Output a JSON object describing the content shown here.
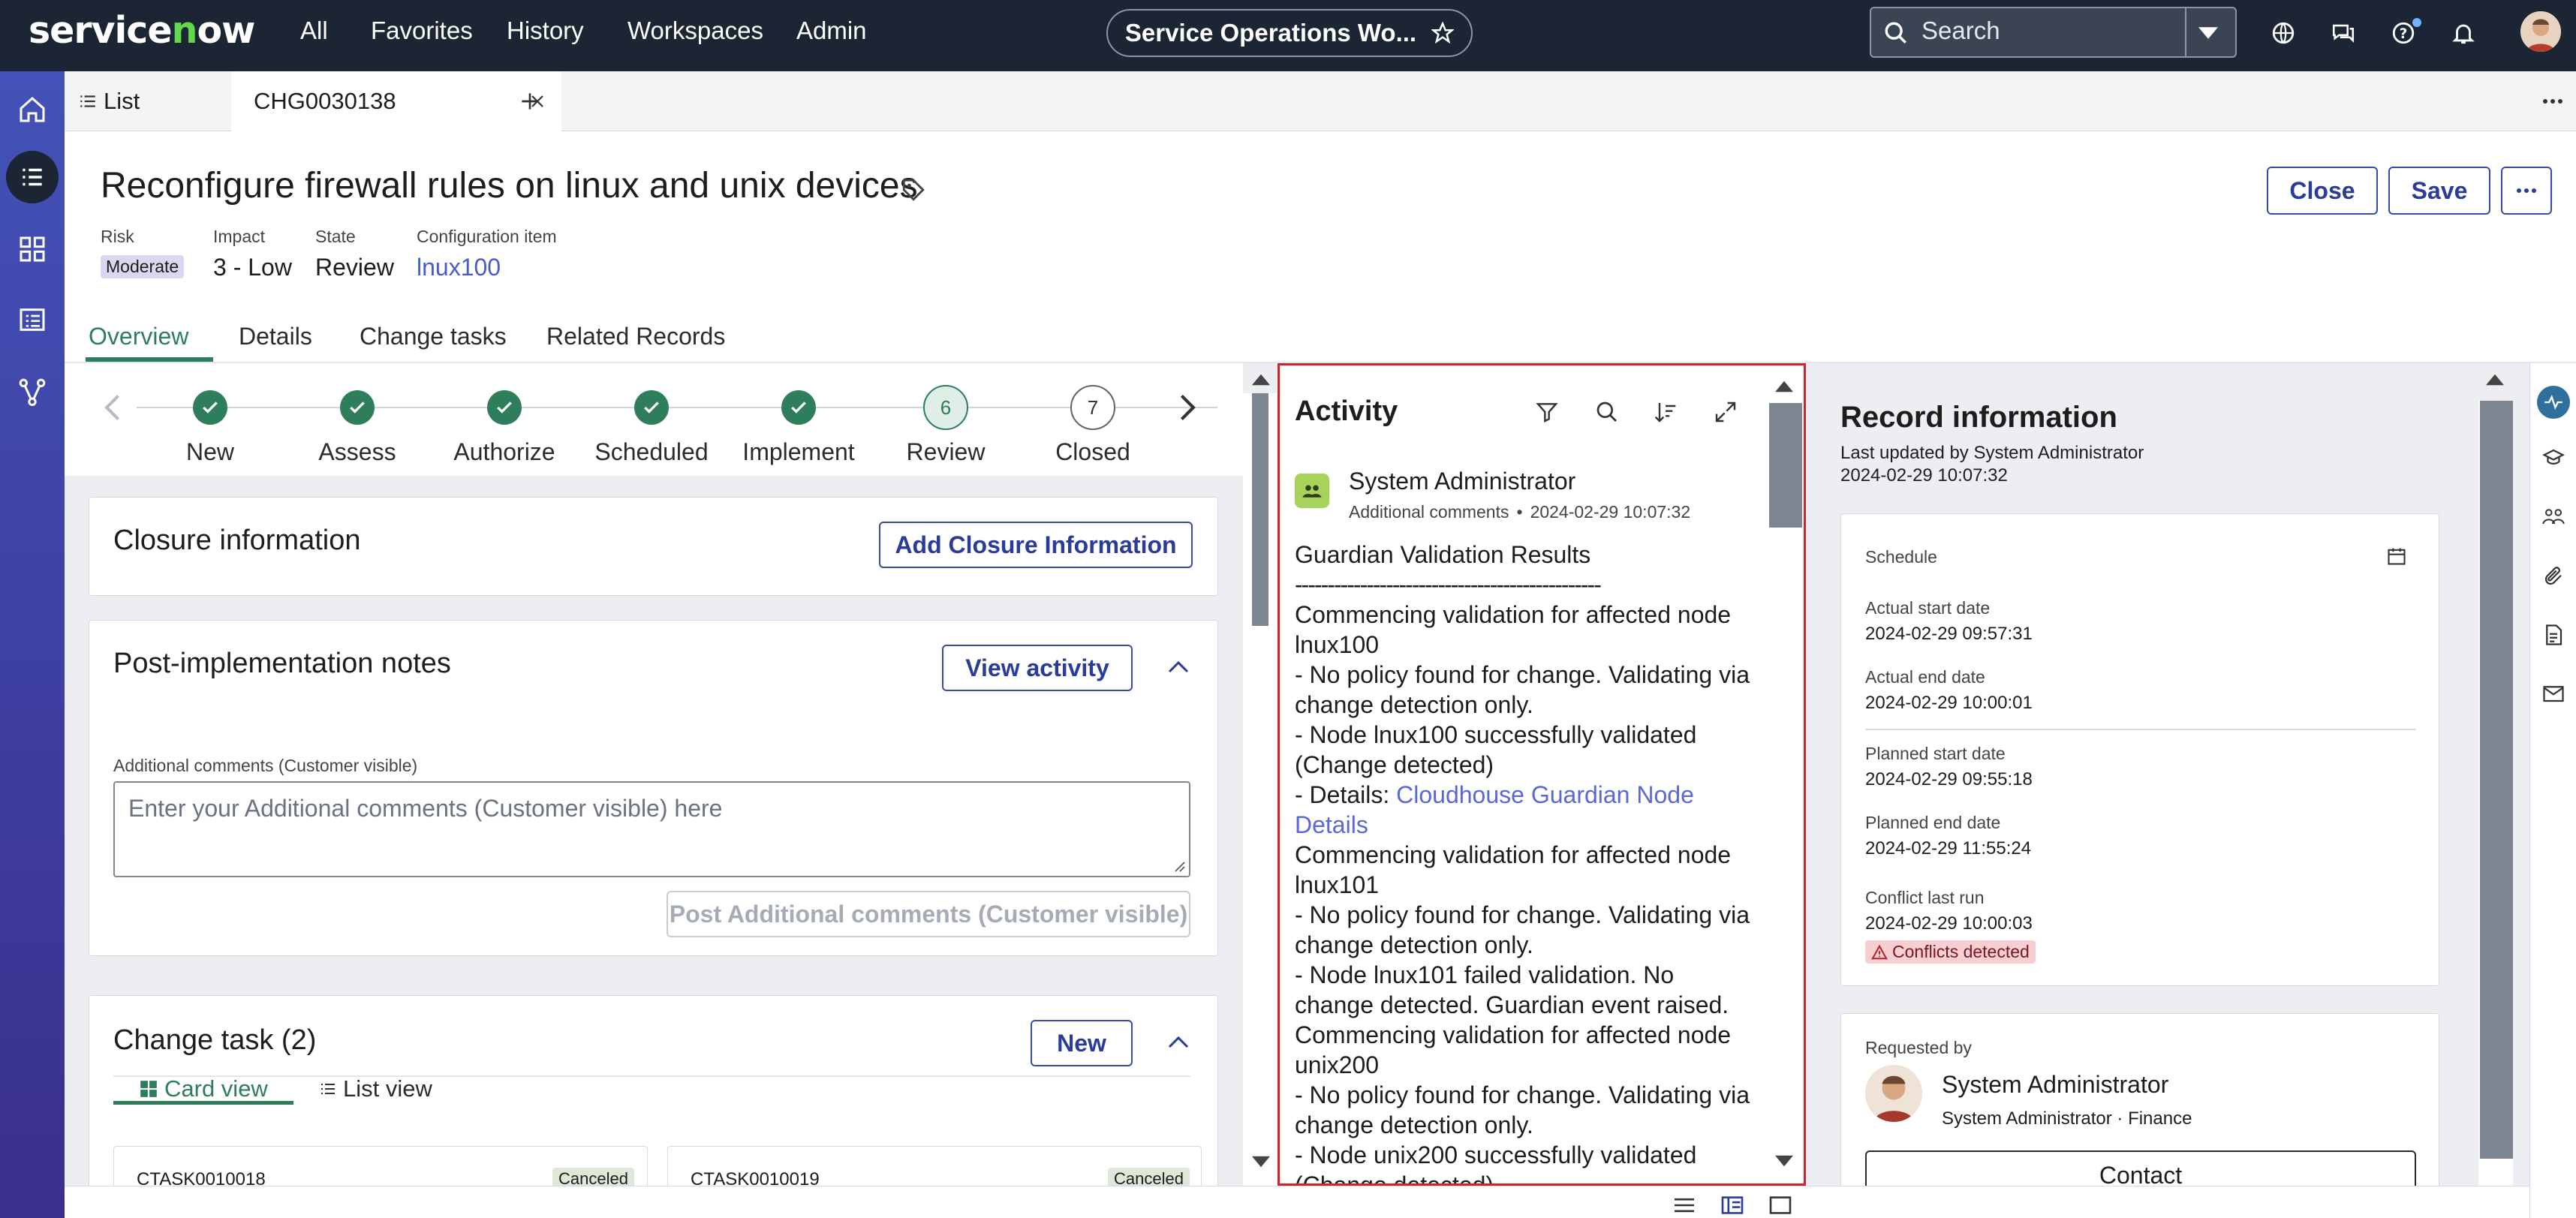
{
  "topbar": {
    "logo": "servicenow",
    "nav": [
      "All",
      "Favorites",
      "History",
      "Workspaces",
      "Admin"
    ],
    "workspace_pill": "Service Operations Wo...",
    "search_placeholder": "Search"
  },
  "tabs": {
    "list": "List",
    "record": "CHG0030138"
  },
  "header": {
    "title": "Reconfigure firewall rules on linux and unix devices",
    "risk_label": "Risk",
    "risk_value": "Moderate",
    "impact_label": "Impact",
    "impact_value": "3 - Low",
    "state_label": "State",
    "state_value": "Review",
    "ci_label": "Configuration item",
    "ci_value": "lnux100",
    "close_button": "Close",
    "save_button": "Save"
  },
  "subtabs": [
    "Overview",
    "Details",
    "Change tasks",
    "Related Records"
  ],
  "stepper": [
    {
      "label": "New",
      "status": "done"
    },
    {
      "label": "Assess",
      "status": "done"
    },
    {
      "label": "Authorize",
      "status": "done"
    },
    {
      "label": "Scheduled",
      "status": "done"
    },
    {
      "label": "Implement",
      "status": "done"
    },
    {
      "label": "Review",
      "status": "current",
      "num": "6"
    },
    {
      "label": "Closed",
      "status": "pending",
      "num": "7"
    }
  ],
  "closure": {
    "title": "Closure information",
    "button": "Add Closure Information"
  },
  "post_impl": {
    "title": "Post-implementation notes",
    "view_activity": "View activity",
    "field_label": "Additional comments (Customer visible)",
    "placeholder": "Enter your Additional comments (Customer visible) here",
    "post_button": "Post Additional comments (Customer visible)"
  },
  "change_task": {
    "title": "Change task (2)",
    "new_button": "New",
    "card_view": "Card view",
    "list_view": "List view",
    "tasks": [
      {
        "number": "CTASK0010018",
        "state": "Canceled"
      },
      {
        "number": "CTASK0010019",
        "state": "Canceled"
      }
    ]
  },
  "activity": {
    "title": "Activity",
    "author": "System Administrator",
    "meta": "Additional comments",
    "timestamp": "2024-02-29 10:07:32",
    "lines": [
      "Guardian Validation Results",
      "-----------------------------------------------",
      "Commencing validation for affected node",
      "lnux100",
      "- No policy found for change. Validating via",
      "change detection only.",
      "- Node lnux100 successfully validated",
      "(Change detected)"
    ],
    "details_prefix": "- Details: ",
    "details_link_1": "Cloudhouse Guardian Node",
    "details_link_2": "Details",
    "lines2": [
      "Commencing validation for affected node",
      "lnux101",
      "- No policy found for change. Validating via",
      "change detection only.",
      "- Node lnux101 failed validation. No",
      "change detected. Guardian event raised.",
      "Commencing validation for affected node",
      "unix200",
      "- No policy found for change. Validating via",
      "change detection only.",
      "- Node unix200 successfully validated",
      "(Change detected)"
    ]
  },
  "record_info": {
    "title": "Record information",
    "updated_by": "Last updated by System Administrator",
    "updated_at": "2024-02-29 10:07:32",
    "schedule_label": "Schedule",
    "actual_start_label": "Actual start date",
    "actual_start": "2024-02-29 09:57:31",
    "actual_end_label": "Actual end date",
    "actual_end": "2024-02-29 10:00:01",
    "planned_start_label": "Planned start date",
    "planned_start": "2024-02-29 09:55:18",
    "planned_end_label": "Planned end date",
    "planned_end": "2024-02-29 11:55:24",
    "conflict_label": "Conflict last run",
    "conflict_run": "2024-02-29 10:00:03",
    "conflict_badge": "Conflicts detected",
    "requested_by_label": "Requested by",
    "requester": "System Administrator",
    "requester_sub": "System Administrator · Finance",
    "contact_button": "Contact"
  },
  "colors": {
    "topbar": "#1b2533",
    "accent": "#2e7d5b",
    "link": "#5a67d8",
    "primary_btn": "#2a3b9a",
    "highlight": "#d0242c"
  }
}
